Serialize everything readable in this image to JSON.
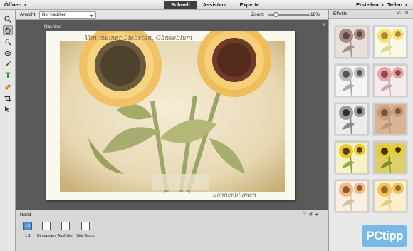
{
  "topbar": {
    "open_label": "Öffnen",
    "modes": [
      {
        "label": "Schnell",
        "active": true
      },
      {
        "label": "Assistent",
        "active": false
      },
      {
        "label": "Experte",
        "active": false
      }
    ],
    "create_label": "Erstellen",
    "share_label": "Teilen"
  },
  "tools": [
    {
      "icon": "zoom-icon",
      "selected": false
    },
    {
      "icon": "hand-icon",
      "selected": true
    },
    {
      "icon": "quick-selection-icon",
      "selected": false
    },
    {
      "icon": "red-eye-icon",
      "selected": false
    },
    {
      "icon": "whiten-teeth-icon",
      "selected": false
    },
    {
      "icon": "type-icon",
      "selected": false
    },
    {
      "icon": "spot-healing-icon",
      "selected": false
    },
    {
      "icon": "crop-icon",
      "selected": false
    },
    {
      "icon": "move-icon",
      "selected": false
    }
  ],
  "options": {
    "view_label": "Ansicht:",
    "view_value": "Nur nachher",
    "zoom_label": "Zoom:",
    "zoom_value": "18%",
    "zoom_fraction": 0.18
  },
  "canvas": {
    "label": "Nachher",
    "close_icon": "close-icon",
    "photo_caption_top": "Von meiner Liebsten, Gänseblum",
    "photo_caption_bottom": "Sonnenblumen"
  },
  "bottom": {
    "title": "Hand",
    "buttons": [
      {
        "label": "1:1",
        "box_text": "1:1",
        "active": true
      },
      {
        "label": "Einpassen",
        "active": false
      },
      {
        "label": "Ausfüllen",
        "active": false
      },
      {
        "label": "Wie Druck",
        "active": false
      }
    ]
  },
  "effects": {
    "title": "Effekte",
    "thumbnails": [
      {
        "name": "effect-sepia-rose",
        "bg": "#e9dfdb",
        "flower": "#a88a83",
        "center": "#5e4740",
        "leaf": "#9f928c"
      },
      {
        "name": "effect-bright-yellow",
        "bg": "#fbf7e6",
        "flower": "#f3e27a",
        "center": "#a88c2d",
        "leaf": "#d9dc8a"
      },
      {
        "name": "effect-mono-light",
        "bg": "#f4f4f4",
        "flower": "#bdbdbd",
        "center": "#555555",
        "leaf": "#aaaaaa"
      },
      {
        "name": "effect-pink-tint",
        "bg": "#f7eaea",
        "flower": "#e6a6a6",
        "center": "#8a4b4b",
        "leaf": "#c9aaaa"
      },
      {
        "name": "effect-mono-dark",
        "bg": "#ececec",
        "flower": "#9e9e9e",
        "center": "#2f2f2f",
        "leaf": "#888888"
      },
      {
        "name": "effect-terracotta",
        "bg": "#d9b596",
        "flower": "#c99a76",
        "center": "#7a5438",
        "leaf": "#b99679"
      },
      {
        "name": "effect-vivid",
        "bg": "#f6f2c8",
        "flower": "#f1c72c",
        "center": "#4b4122",
        "leaf": "#8ea83f"
      },
      {
        "name": "effect-saturated",
        "bg": "#dccf6a",
        "flower": "#e9c92b",
        "center": "#3d3410",
        "leaf": "#7d8b2a"
      },
      {
        "name": "effect-peach",
        "bg": "#fbeee2",
        "flower": "#f1b987",
        "center": "#8c5a34",
        "leaf": "#d8c1a2"
      },
      {
        "name": "effect-golden",
        "bg": "#fbefcc",
        "flower": "#f4c25a",
        "center": "#9a6b20",
        "leaf": "#e2cc8a"
      }
    ]
  },
  "watermark": "PCtipp"
}
